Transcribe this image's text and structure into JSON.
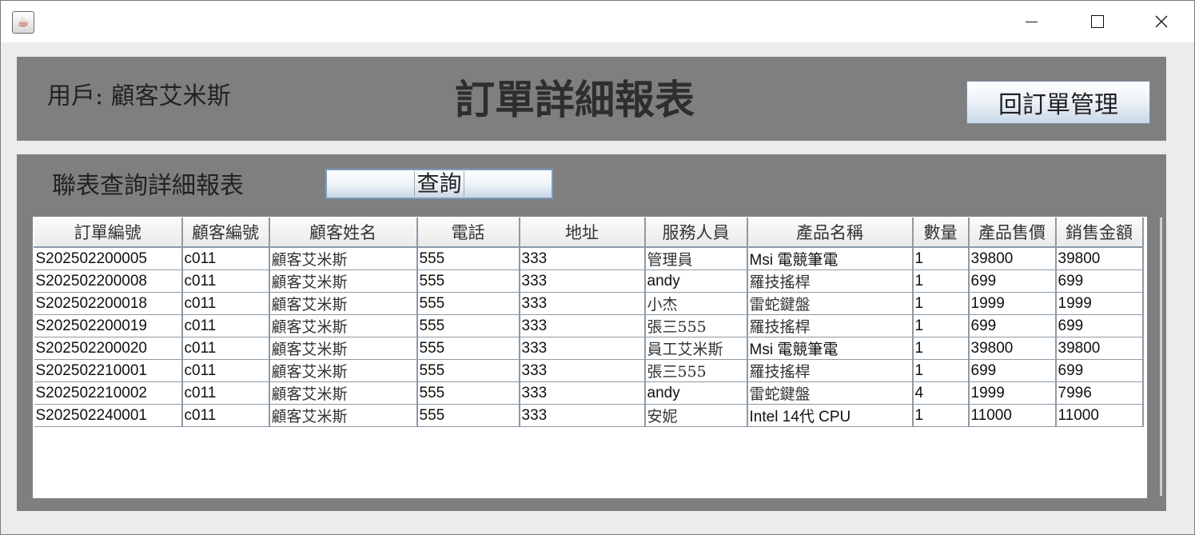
{
  "window": {
    "app_icon": "java-coffee-icon",
    "controls": {
      "minimize": "minimize-icon",
      "maximize": "maximize-icon",
      "close": "close-icon"
    }
  },
  "header": {
    "user_label": "用戶: 顧客艾米斯",
    "title": "訂單詳細報表",
    "back_button_label": "回訂單管理"
  },
  "query": {
    "section_label": "聯表查詢詳細報表",
    "button_label": "查詢"
  },
  "table": {
    "columns": [
      "訂單編號",
      "顧客編號",
      "顧客姓名",
      "電話",
      "地址",
      "服務人員",
      "產品名稱",
      "數量",
      "產品售價",
      "銷售金額"
    ],
    "rows": [
      [
        "S202502200005",
        "c011",
        "顧客艾米斯",
        "555",
        "333",
        "管理員",
        "Msi 電競筆電",
        "1",
        "39800",
        "39800"
      ],
      [
        "S202502200008",
        "c011",
        "顧客艾米斯",
        "555",
        "333",
        "andy",
        "羅技搖桿",
        "1",
        "699",
        "699"
      ],
      [
        "S202502200018",
        "c011",
        "顧客艾米斯",
        "555",
        "333",
        "小杰",
        "雷蛇鍵盤",
        "1",
        "1999",
        "1999"
      ],
      [
        "S202502200019",
        "c011",
        "顧客艾米斯",
        "555",
        "333",
        "張三555",
        "羅技搖桿",
        "1",
        "699",
        "699"
      ],
      [
        "S202502200020",
        "c011",
        "顧客艾米斯",
        "555",
        "333",
        "員工艾米斯",
        "Msi 電競筆電",
        "1",
        "39800",
        "39800"
      ],
      [
        "S202502210001",
        "c011",
        "顧客艾米斯",
        "555",
        "333",
        "張三555",
        "羅技搖桿",
        "1",
        "699",
        "699"
      ],
      [
        "S202502210002",
        "c011",
        "顧客艾米斯",
        "555",
        "333",
        "andy",
        "雷蛇鍵盤",
        "4",
        "1999",
        "7996"
      ],
      [
        "S202502240001",
        "c011",
        "顧客艾米斯",
        "555",
        "333",
        "安妮",
        "Intel 14代 CPU",
        "1",
        "11000",
        "11000"
      ]
    ]
  }
}
